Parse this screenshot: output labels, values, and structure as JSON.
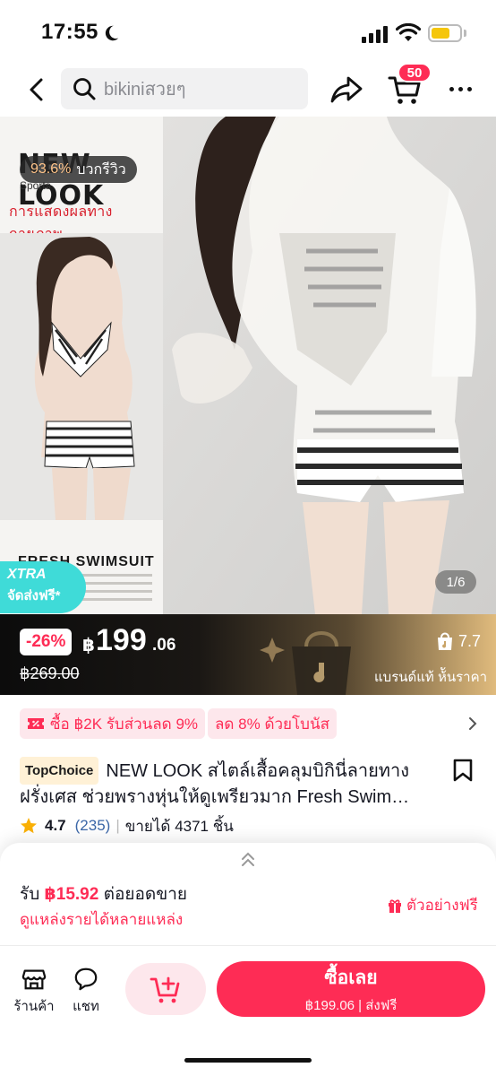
{
  "status_bar": {
    "time": "17:55"
  },
  "header": {
    "search_placeholder": "bikiniสวยๆ",
    "cart_count": "50"
  },
  "gallery": {
    "brand_title": "NEW LOOK",
    "brand_sub": "Sports",
    "rating_pct": "93.6%",
    "rating_text": "บวกรีวิว",
    "caption": "การแสดงผลทางกายภาพ",
    "fresh_title": "FRESH SWIMSUIT",
    "xtra_label": "XTRA",
    "xtra_sub": "จัดส่งฟรี*",
    "page_indicator": "1/6"
  },
  "price": {
    "discount": "-26%",
    "currency": "฿",
    "main": "199",
    "decimal": ".06",
    "original": "฿269.00",
    "brand_score": "7.7",
    "brand_label": "แบรนด์แท้ ห้ันราคา"
  },
  "promos": [
    {
      "label": "ซื้อ ฿2K รับส่วนลด 9%"
    },
    {
      "label": "ลด 8% ด้วยโบนัส"
    }
  ],
  "product": {
    "badge": "TopChoice",
    "title": "NEW LOOK สไตล์เสื้อคลุมบิกินี่ลายทางฝรั่งเศส ช่วยพรางหุ่นให้ดูเพรียวมาก Fresh Swim…",
    "rating": "4.7",
    "review_count": "(235)",
    "sold": "ขายได้ 4371 ชิ้น"
  },
  "sheet": {
    "earn_prefix": "รับ",
    "earn_amount": "฿15.92",
    "earn_suffix": "ต่อยอดขาย",
    "earn_sub": "ดูแหล่งรายได้หลายแหล่ง",
    "sample_label": "ตัวอย่างฟรี"
  },
  "actions": {
    "shop_label": "ร้านค้า",
    "chat_label": "แชท",
    "buy_label": "ซื้อเลย",
    "buy_sub": "฿199.06 | ส่งฟรี"
  },
  "colors": {
    "accent": "#fe2c55",
    "accent_soft": "#fde7ec",
    "xtra": "#3fdbd8",
    "battery": "#f5c60b"
  }
}
